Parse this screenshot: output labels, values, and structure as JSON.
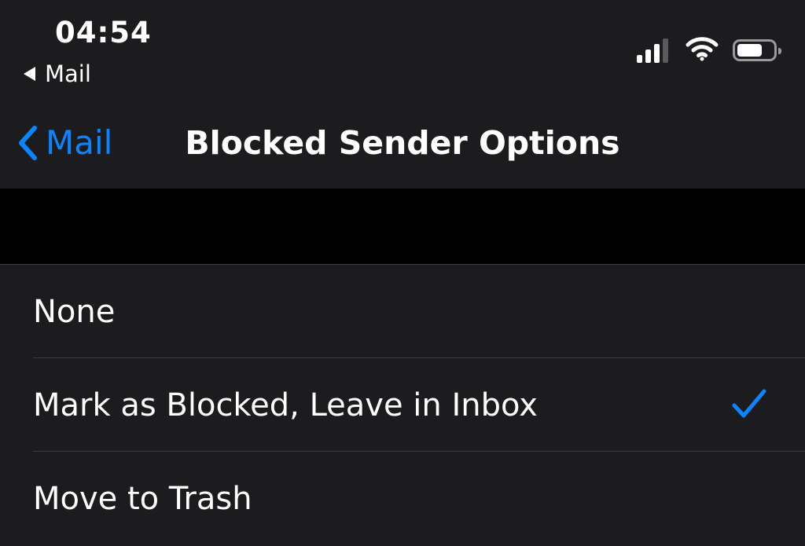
{
  "status_bar": {
    "time": "04:54",
    "back_app_label": "Mail",
    "signal_bars_active": 3,
    "signal_bars_total": 4,
    "battery_level": 0.7
  },
  "nav": {
    "back_label": "Mail",
    "title": "Blocked Sender Options"
  },
  "options": [
    {
      "label": "None",
      "selected": false
    },
    {
      "label": "Mark as Blocked, Leave in Inbox",
      "selected": true
    },
    {
      "label": "Move to Trash",
      "selected": false
    }
  ],
  "colors": {
    "accent": "#0a84ff",
    "background": "#000000",
    "cell_background": "#1c1c1e",
    "separator": "#3a3a3c",
    "text": "#ffffff"
  }
}
